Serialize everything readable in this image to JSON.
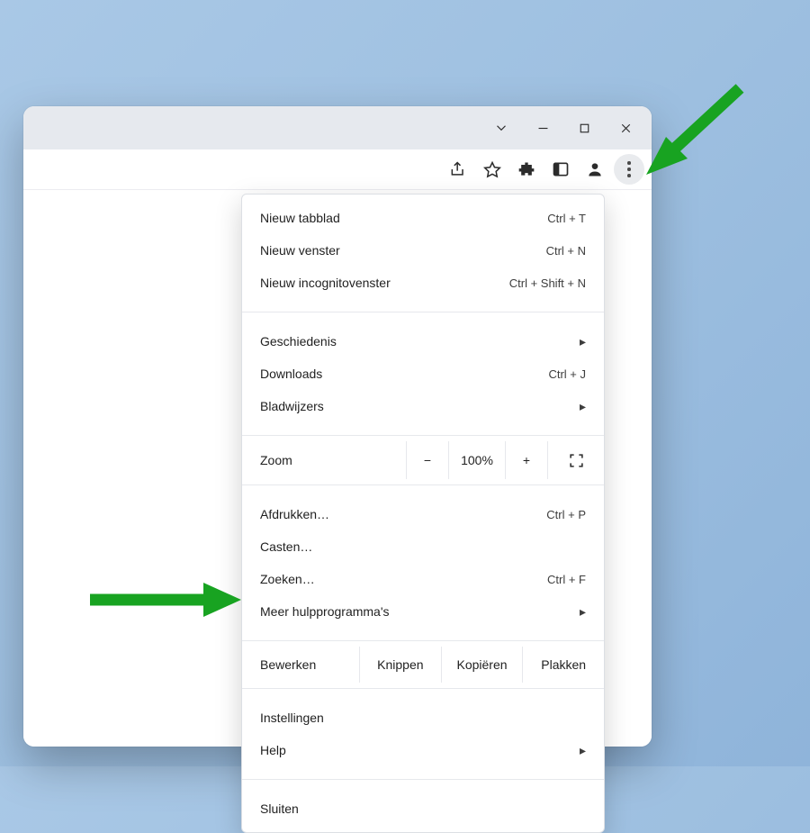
{
  "menu": {
    "new_tab": {
      "label": "Nieuw tabblad",
      "shortcut": "Ctrl + T"
    },
    "new_window": {
      "label": "Nieuw venster",
      "shortcut": "Ctrl + N"
    },
    "new_incognito": {
      "label": "Nieuw incognitovenster",
      "shortcut": "Ctrl + Shift + N"
    },
    "history": {
      "label": "Geschiedenis"
    },
    "downloads": {
      "label": "Downloads",
      "shortcut": "Ctrl + J"
    },
    "bookmarks": {
      "label": "Bladwijzers"
    },
    "zoom": {
      "label": "Zoom",
      "minus": "−",
      "value": "100%",
      "plus": "+"
    },
    "print": {
      "label": "Afdrukken…",
      "shortcut": "Ctrl + P"
    },
    "cast": {
      "label": "Casten…"
    },
    "find": {
      "label": "Zoeken…",
      "shortcut": "Ctrl + F"
    },
    "more_tools": {
      "label": "Meer hulpprogramma's"
    },
    "edit": {
      "label": "Bewerken",
      "cut": "Knippen",
      "copy": "Kopiëren",
      "paste": "Plakken"
    },
    "settings": {
      "label": "Instellingen"
    },
    "help": {
      "label": "Help"
    },
    "exit": {
      "label": "Sluiten"
    }
  }
}
